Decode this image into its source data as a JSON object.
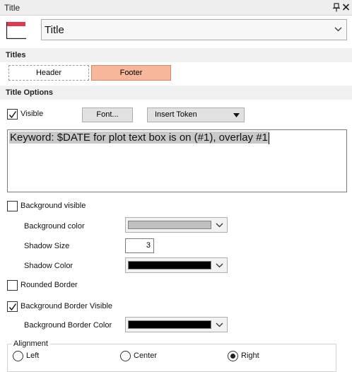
{
  "window": {
    "title": "Title"
  },
  "header": {
    "type_value": "Title"
  },
  "sections": {
    "titles": "Titles",
    "title_options": "Title Options"
  },
  "tabs": [
    {
      "label": "Header",
      "selected": false
    },
    {
      "label": "Footer",
      "selected": true
    }
  ],
  "options": {
    "visible": {
      "label": "Visible",
      "checked": true
    },
    "font_button": "Font...",
    "insert_token": "Insert Token",
    "text": "Keyword: $DATE for plot text box is on (#1), overlay #1",
    "background_visible": {
      "label": "Background visible",
      "checked": false
    },
    "background_color": {
      "label": "Background color",
      "color": "#c0c0c0"
    },
    "shadow_size": {
      "label": "Shadow Size",
      "value": "3"
    },
    "shadow_color": {
      "label": "Shadow Color",
      "color": "#000000"
    },
    "rounded_border": {
      "label": "Rounded Border",
      "checked": false
    },
    "background_border_visible": {
      "label": "Background Border Visible",
      "checked": true
    },
    "background_border_color": {
      "label": "Background Border Color",
      "color": "#000000"
    }
  },
  "alignment": {
    "label": "Alignment",
    "options": [
      {
        "label": "Left",
        "selected": false
      },
      {
        "label": "Center",
        "selected": false
      },
      {
        "label": "Right",
        "selected": true
      }
    ]
  },
  "colors": {
    "accent_tab": "#f7b79b",
    "accent_tab_border": "#d08a6a",
    "icon_red": "#e23a4a"
  }
}
